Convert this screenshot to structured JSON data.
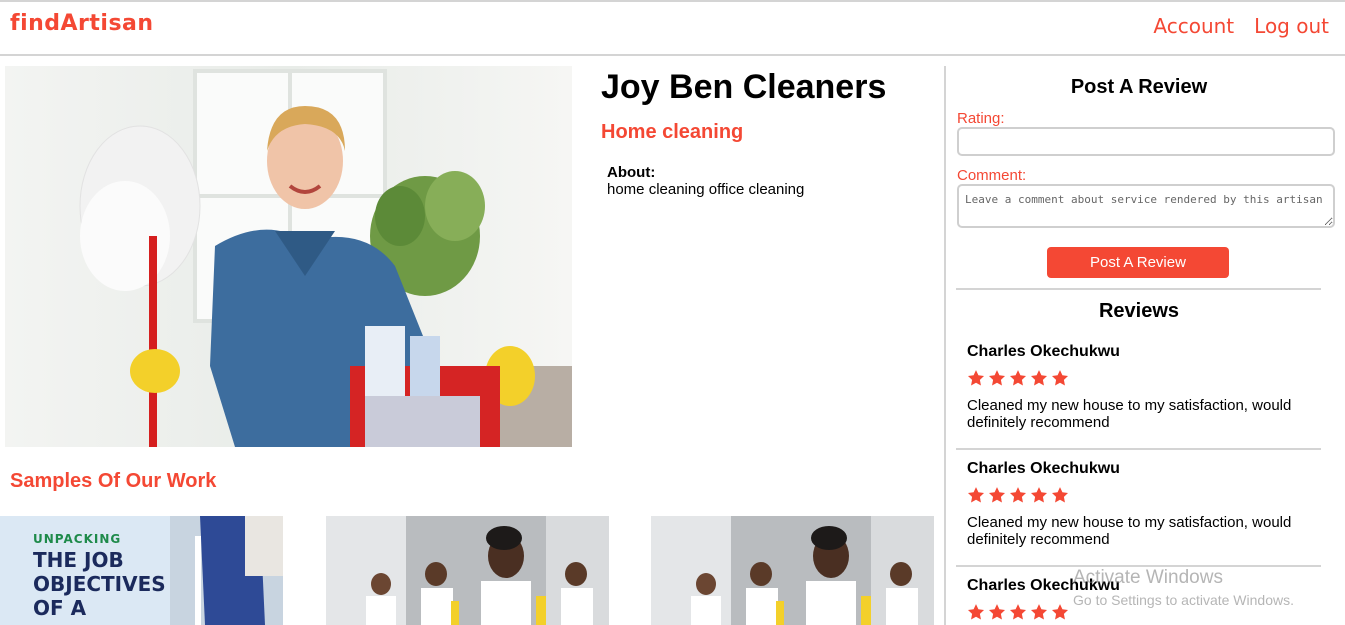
{
  "header": {
    "logo": "findArtisan",
    "nav": {
      "account": "Account",
      "logout": "Log out"
    }
  },
  "profile": {
    "name": "Joy Ben Cleaners",
    "category": "Home cleaning",
    "about_label": "About:",
    "about_text": "home cleaning office cleaning"
  },
  "samples": {
    "heading": "Samples Of Our Work",
    "items": [
      {
        "line1": "UNPACKING",
        "line2": "THE JOB",
        "line3": "OBJECTIVES",
        "line4": "OF A"
      },
      {
        "caption": ""
      },
      {
        "caption": ""
      }
    ]
  },
  "review_form": {
    "title": "Post A Review",
    "rating_label": "Rating:",
    "rating_value": "",
    "comment_label": "Comment:",
    "comment_placeholder": "Leave a comment about service rendered by this artisan",
    "submit_label": "Post A Review"
  },
  "reviews": {
    "title": "Reviews",
    "items": [
      {
        "author": "Charles Okechukwu",
        "rating": 5,
        "text": "Cleaned my new house to my satisfaction, would definitely recommend"
      },
      {
        "author": "Charles Okechukwu",
        "rating": 5,
        "text": "Cleaned my new house to my satisfaction, would definitely recommend"
      },
      {
        "author": "Charles Okechukwu",
        "rating": 5,
        "text": ""
      }
    ]
  },
  "watermark": {
    "title": "Activate Windows",
    "subtitle": "Go to Settings to activate Windows."
  },
  "colors": {
    "accent": "#f44834",
    "divider": "#d4d4d4"
  }
}
